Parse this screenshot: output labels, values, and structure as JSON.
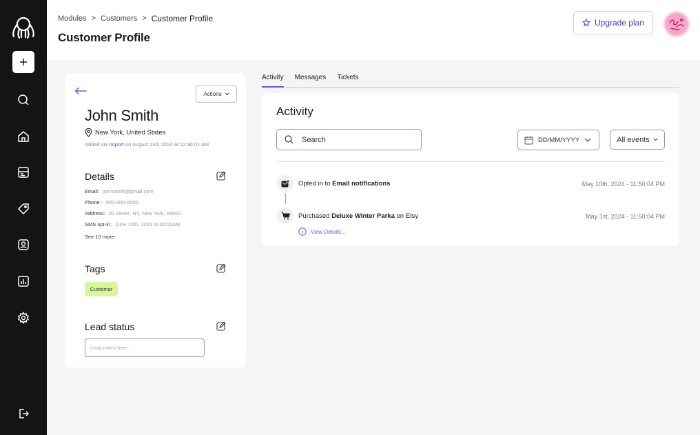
{
  "breadcrumb": {
    "items": [
      "Modules",
      "Customers"
    ],
    "separator": ">",
    "current": "Customer Profile"
  },
  "page": {
    "title": "Customer Profile"
  },
  "header": {
    "upgrade_label": "Upgrade plan"
  },
  "profile": {
    "actions_label": "Actions",
    "name": "John Smith",
    "location": "New York, United States",
    "added_prefix": "Added via ",
    "added_source": "Import",
    "added_suffix": " on August 2nd, 2024 at 12:30:01 AM"
  },
  "details": {
    "title": "Details",
    "rows": [
      {
        "label": "Email:",
        "value": "johnsmith@gmail.com"
      },
      {
        "label": "Phone :",
        "value": "000-000-0000"
      },
      {
        "label": "Address:",
        "value": "00 Street, NY, New York, 08000"
      },
      {
        "label": "SMS opt-in:",
        "value": "June 12th, 2023 at 00:00AM"
      }
    ],
    "see_more": "See 10 more"
  },
  "tags": {
    "title": "Tags",
    "items": [
      "Customer"
    ]
  },
  "lead": {
    "title": "Lead status",
    "placeholder": "Lead notes here..."
  },
  "tabs": {
    "items": [
      "Activity",
      "Messages",
      "Tickets"
    ],
    "active": "Activity"
  },
  "activity": {
    "title": "Activity",
    "search_placeholder": "Search",
    "date_placeholder": "DD/MM/YYYY",
    "events_filter": "All events",
    "events": [
      {
        "icon": "mail-icon",
        "prefix": "Opted in to ",
        "bold": "Email notifications",
        "suffix": "",
        "time": "May 10th, 2024 - 11:50:04 PM"
      },
      {
        "icon": "cart-icon",
        "prefix": "Purchased ",
        "bold": "Deluxe Winter Parka",
        "suffix": " on Etsy",
        "time": "May 1st, 2024 - 11:50:04 PM"
      }
    ],
    "view_details": "View Details..."
  },
  "colors": {
    "sidebar": "#141414",
    "accent": "#5a5fd8",
    "tag": "#d7f59a",
    "avatar": "#f6a6c9"
  }
}
